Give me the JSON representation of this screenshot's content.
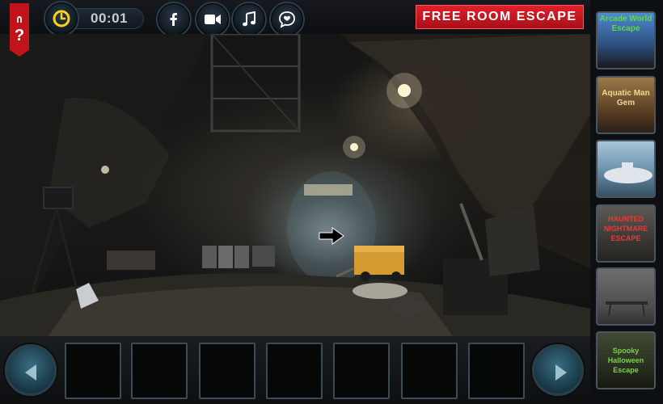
{
  "timer": {
    "value": "00:01"
  },
  "help": {
    "label": "?"
  },
  "promo": {
    "label": "FREE ROOM ESCAPE"
  },
  "social": [
    {
      "name": "facebook-icon"
    },
    {
      "name": "video-camera-icon"
    },
    {
      "name": "music-note-icon"
    },
    {
      "name": "heart-chat-icon"
    }
  ],
  "sidebar_games": [
    {
      "title": "Arcade World Escape",
      "color": "#62d84a"
    },
    {
      "title": "Aquatic Man Gem",
      "color": "#f0d890"
    },
    {
      "title": "",
      "color": "#d6e6ee"
    },
    {
      "title": "HAUNTED NIGHTMARE ESCAPE",
      "color": "#e83a3a"
    },
    {
      "title": "",
      "color": "#aaaaaa"
    },
    {
      "title": "Spooky Halloween Escape",
      "color": "#7ad04a"
    }
  ],
  "inventory": {
    "slots": 7
  },
  "colors": {
    "promo": "#c8141e",
    "slot_border": "#3c4a54",
    "accent": "#2a5a6c"
  }
}
